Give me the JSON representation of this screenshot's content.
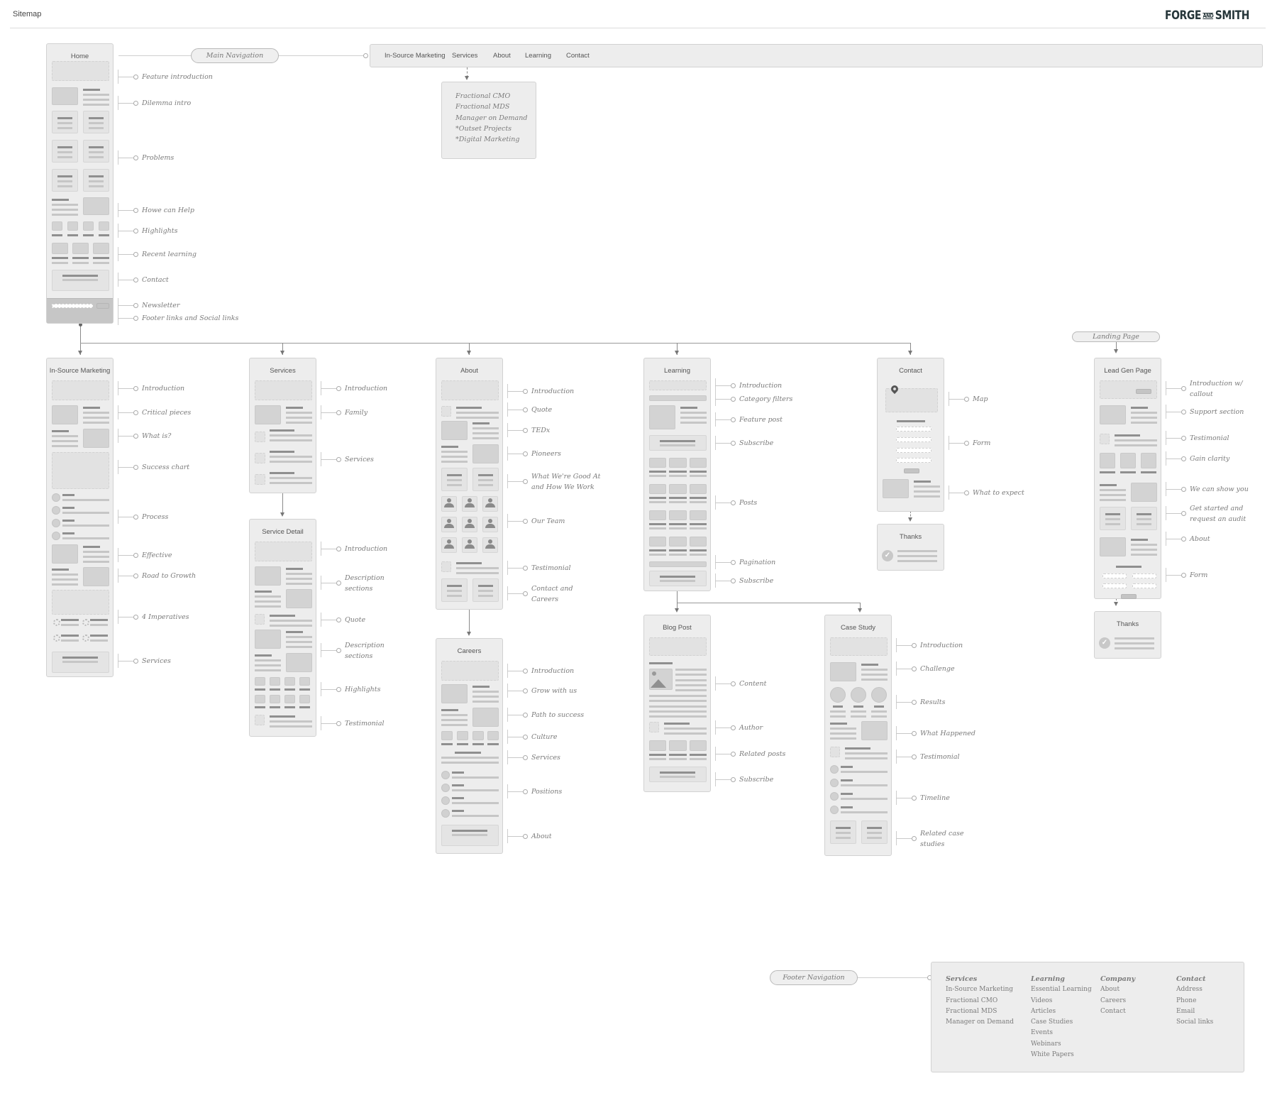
{
  "header": {
    "title": "Sitemap",
    "logo": {
      "left": "FORGE",
      "mid": "AND",
      "right": "SMITH",
      "color": "#26363a"
    }
  },
  "main_nav": {
    "pill_label": "Main Navigation",
    "items": [
      "In-Source Marketing",
      "Services",
      "About",
      "Learning",
      "Contact"
    ],
    "services_dropdown": [
      "Fractional CMO",
      "Fractional MDS",
      "Manager on Demand",
      "*Outset Projects",
      "*Digital Marketing"
    ]
  },
  "pages": {
    "home": {
      "title": "Home",
      "annotations": [
        "Feature introduction",
        "Dilemma intro",
        "Problems",
        "Howe can Help",
        "Highlights",
        "Recent learning",
        "Contact",
        "Newsletter",
        "Footer links and Social links"
      ]
    },
    "insource": {
      "title": "In-Source Marketing",
      "annotations": [
        "Introduction",
        "Critical pieces",
        "What is?",
        "Success chart",
        "Process",
        "Effective",
        "Road to Growth",
        "4 Imperatives",
        "Services"
      ]
    },
    "services": {
      "title": "Services",
      "annotations": [
        "Introduction",
        "Family",
        "Services"
      ]
    },
    "service_detail": {
      "title": "Service Detail",
      "annotations": [
        "Introduction",
        "Description sections",
        "Quote",
        "Description sections",
        "Highlights",
        "Testimonial"
      ]
    },
    "about": {
      "title": "About",
      "annotations": [
        "Introduction",
        "Quote",
        "TEDx",
        "Pioneers",
        "What We're Good At and How We Work",
        "Our Team",
        "Testimonial",
        "Contact and Careers"
      ]
    },
    "careers": {
      "title": "Careers",
      "annotations": [
        "Introduction",
        "Grow with us",
        "Path to success",
        "Culture",
        "Services",
        "Positions",
        "About"
      ]
    },
    "learning": {
      "title": "Learning",
      "annotations": [
        "Introduction",
        "Category filters",
        "Feature post",
        "Subscribe",
        "Posts",
        "Pagination",
        "Subscribe"
      ]
    },
    "blog_post": {
      "title": "Blog Post",
      "annotations": [
        "Content",
        "Author",
        "Related posts",
        "Subscribe"
      ]
    },
    "case_study": {
      "title": "Case Study",
      "annotations": [
        "Introduction",
        "Challenge",
        "Results",
        "What Happened",
        "Testimonial",
        "Timeline",
        "Related case studies"
      ]
    },
    "contact": {
      "title": "Contact",
      "annotations": [
        "Map",
        "Form",
        "What to expect"
      ]
    },
    "contact_thanks": {
      "title": "Thanks",
      "annotations": []
    },
    "lead_gen": {
      "title": "Lead Gen Page",
      "annotations": [
        "Introduction w/ callout",
        "Support section",
        "Testimonial",
        "Gain clarity",
        "We can show you",
        "Get started and request an audit",
        "About",
        "Form"
      ]
    },
    "lead_thanks": {
      "title": "Thanks",
      "annotations": []
    }
  },
  "landing_pill": "Landing Page",
  "footer_nav": {
    "pill_label": "Footer Navigation",
    "columns": [
      {
        "heading": "Services",
        "items": [
          "In-Source Marketing",
          "Fractional CMO",
          "Fractional MDS",
          "Manager on Demand"
        ]
      },
      {
        "heading": "Learning",
        "items": [
          "Essential Learning",
          "Videos",
          "Articles",
          "Case Studies",
          "Events",
          "Webinars",
          "White Papers"
        ]
      },
      {
        "heading": "Company",
        "items": [
          "About",
          "Careers",
          "Contact"
        ]
      },
      {
        "heading": "Contact",
        "items": [
          "Address",
          "Phone",
          "Email",
          "Social links"
        ]
      }
    ]
  }
}
